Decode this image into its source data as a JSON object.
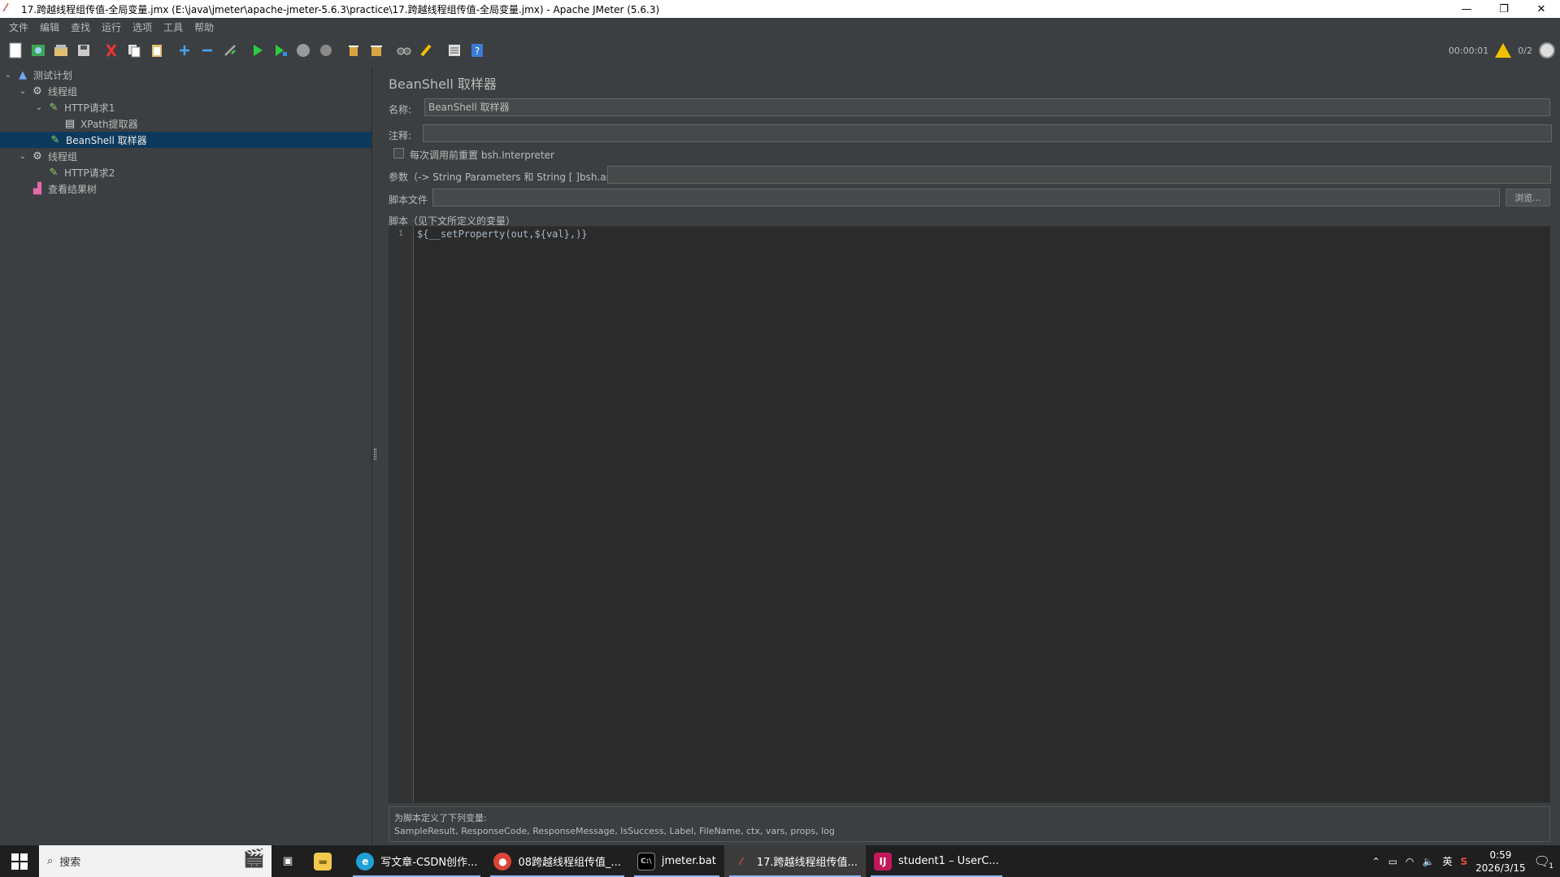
{
  "window": {
    "title": "17.跨越线程组传值-全局变量.jmx (E:\\java\\jmeter\\apache-jmeter-5.6.3\\practice\\17.跨越线程组传值-全局变量.jmx) - Apache JMeter (5.6.3)",
    "minimize": "—",
    "restore": "❐",
    "close": "✕"
  },
  "menu": [
    "文件",
    "编辑",
    "查找",
    "运行",
    "选项",
    "工具",
    "帮助"
  ],
  "toolbar": {
    "timer": "00:00:01",
    "threads": "0/2"
  },
  "tree": [
    {
      "label": "测试计划",
      "icon": "test-plan-icon"
    },
    {
      "label": "线程组",
      "icon": "gear-icon"
    },
    {
      "label": "HTTP请求1",
      "icon": "pen-icon"
    },
    {
      "label": "XPath提取器",
      "icon": "document-icon"
    },
    {
      "label": "BeanShell 取样器",
      "icon": "pen-icon"
    },
    {
      "label": "线程组",
      "icon": "gear-icon"
    },
    {
      "label": "HTTP请求2",
      "icon": "pen-icon"
    },
    {
      "label": "查看结果树",
      "icon": "chart-icon"
    }
  ],
  "panel": {
    "title": "BeanShell 取样器",
    "name_label": "名称:",
    "name_value": "BeanShell 取样器",
    "comment_label": "注释:",
    "comment_value": "",
    "reset_label": "每次调用前重置 bsh.Interpreter",
    "params_label": "参数（-> String Parameters 和 String [ ]bsh.args）",
    "params_value": "",
    "file_label": "脚本文件",
    "file_value": "",
    "browse_label": "浏览...",
    "script_label": "脚本（见下文所定义的变量）",
    "line_number": "1",
    "script_code": "${__setProperty(out,${val},)}",
    "vars_title": "为脚本定义了下列变量:",
    "vars_list": "SampleResult, ResponseCode, ResponseMessage, IsSuccess, Label, FileName, ctx, vars, props, log"
  },
  "taskbar": {
    "search": "搜索",
    "apps": [
      {
        "label": "写文章-CSDN创作..."
      },
      {
        "label": "08跨越线程组传值_..."
      },
      {
        "label": "jmeter.bat"
      },
      {
        "label": "17.跨越线程组传值..."
      },
      {
        "label": "student1 – UserC..."
      }
    ],
    "ime": "英",
    "time": "0:59",
    "date": "2026/3/15",
    "notif_count": "1"
  }
}
